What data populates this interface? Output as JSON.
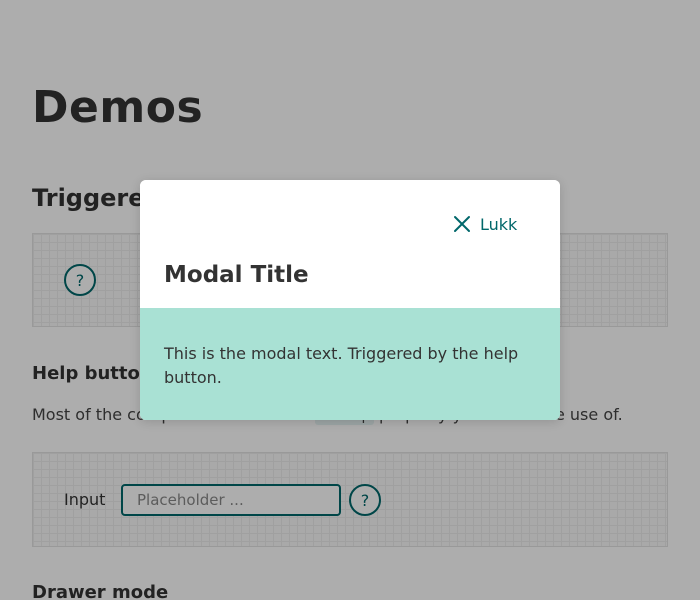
{
  "page": {
    "title": "Demos",
    "section_title": "Triggered by",
    "help_button_heading": "Help button",
    "paragraph_before": "Most of the components do have a ",
    "paragraph_code": "onHelp",
    "paragraph_after": " property you can make use of.",
    "help_button_glyph": "?",
    "input_label": "Input",
    "input_placeholder": "Placeholder ...",
    "drawer_heading": "Drawer mode"
  },
  "modal": {
    "close_label": "Lukk",
    "title": "Modal Title",
    "text": "This is the modal text. Triggered by the help button."
  },
  "colors": {
    "accent": "#00676a",
    "modal_body_bg": "#a9e1d4",
    "overlay": "rgba(0,0,0,0.32)"
  },
  "icons": {
    "close": "close-icon",
    "help": "question-mark-icon"
  }
}
